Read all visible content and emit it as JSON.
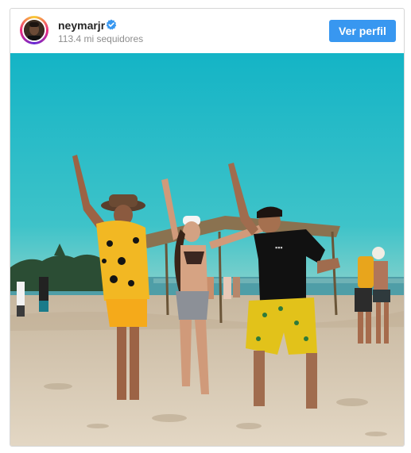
{
  "profile": {
    "username": "neymarjr",
    "followers": "113.4 mi sequidores",
    "verified": true,
    "verified_icon": "verified-badge-icon"
  },
  "actions": {
    "view_profile_label": "Ver perfil"
  },
  "colors": {
    "button": "#3897f0",
    "sky": "#1fb6c4",
    "sand": "#dcccb3"
  }
}
